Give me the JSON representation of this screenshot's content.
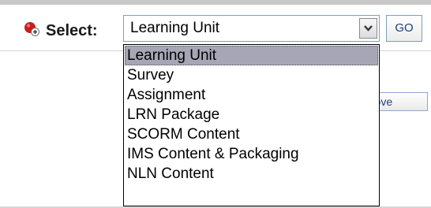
{
  "toolbar": {
    "add_icon": "add-icon",
    "select_label": "Select:",
    "selected_value": "Learning Unit",
    "dropdown_arrow_icon": "chevron-down-icon",
    "go_label": "GO"
  },
  "dropdown": {
    "options": [
      "Learning Unit",
      "Survey",
      "Assignment",
      "LRN Package",
      "SCORM Content",
      "IMS Content & Packaging",
      "NLN Content"
    ],
    "highlighted_index": 0
  },
  "background": {
    "remove_label": "Remove"
  },
  "colors": {
    "accent_red": "#cc2222",
    "highlight": "#a6a6b6",
    "border_blue": "#7f9db9",
    "button_text": "#1f3f7a"
  }
}
